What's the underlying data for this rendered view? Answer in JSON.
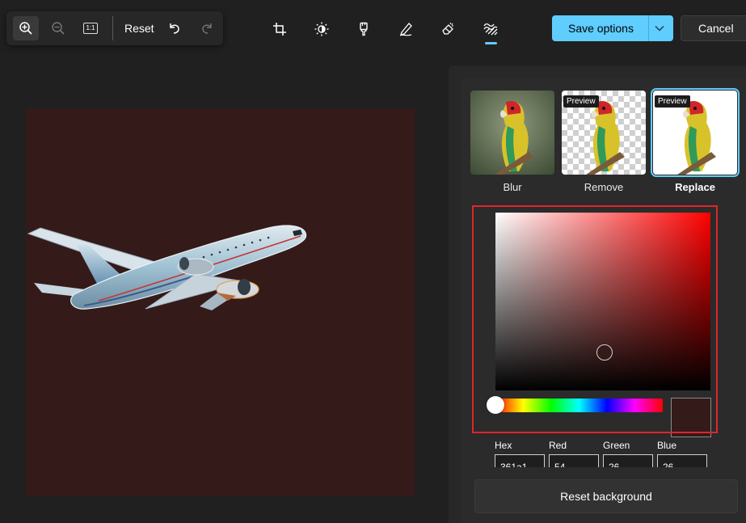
{
  "toolbar": {
    "reset_label": "Reset",
    "actual_size_label": "1:1",
    "zoom_in_icon": "zoom-in-icon",
    "zoom_out_icon": "zoom-out-icon",
    "undo_icon": "undo-icon",
    "redo_icon": "redo-icon"
  },
  "tools": [
    {
      "name": "crop-icon"
    },
    {
      "name": "adjust-icon"
    },
    {
      "name": "filter-icon"
    },
    {
      "name": "markup-icon"
    },
    {
      "name": "erase-icon"
    },
    {
      "name": "background-icon",
      "selected": true
    }
  ],
  "actions": {
    "save_label": "Save options",
    "cancel_label": "Cancel"
  },
  "background_panel": {
    "options": [
      {
        "label": "Blur",
        "preview": ""
      },
      {
        "label": "Remove",
        "preview": "Preview"
      },
      {
        "label": "Replace",
        "preview": "Preview",
        "selected": true
      }
    ],
    "color_picker": {
      "current_color": "#351a1a",
      "fields": [
        {
          "label": "Hex",
          "value": "361a1"
        },
        {
          "label": "Red",
          "value": "54"
        },
        {
          "label": "Green",
          "value": "26"
        },
        {
          "label": "Blue",
          "value": "26"
        }
      ]
    },
    "reset_label": "Reset background"
  },
  "colors": {
    "accent": "#60cdff",
    "canvas_background": "#351a1a",
    "highlight_border": "#e0252b"
  }
}
